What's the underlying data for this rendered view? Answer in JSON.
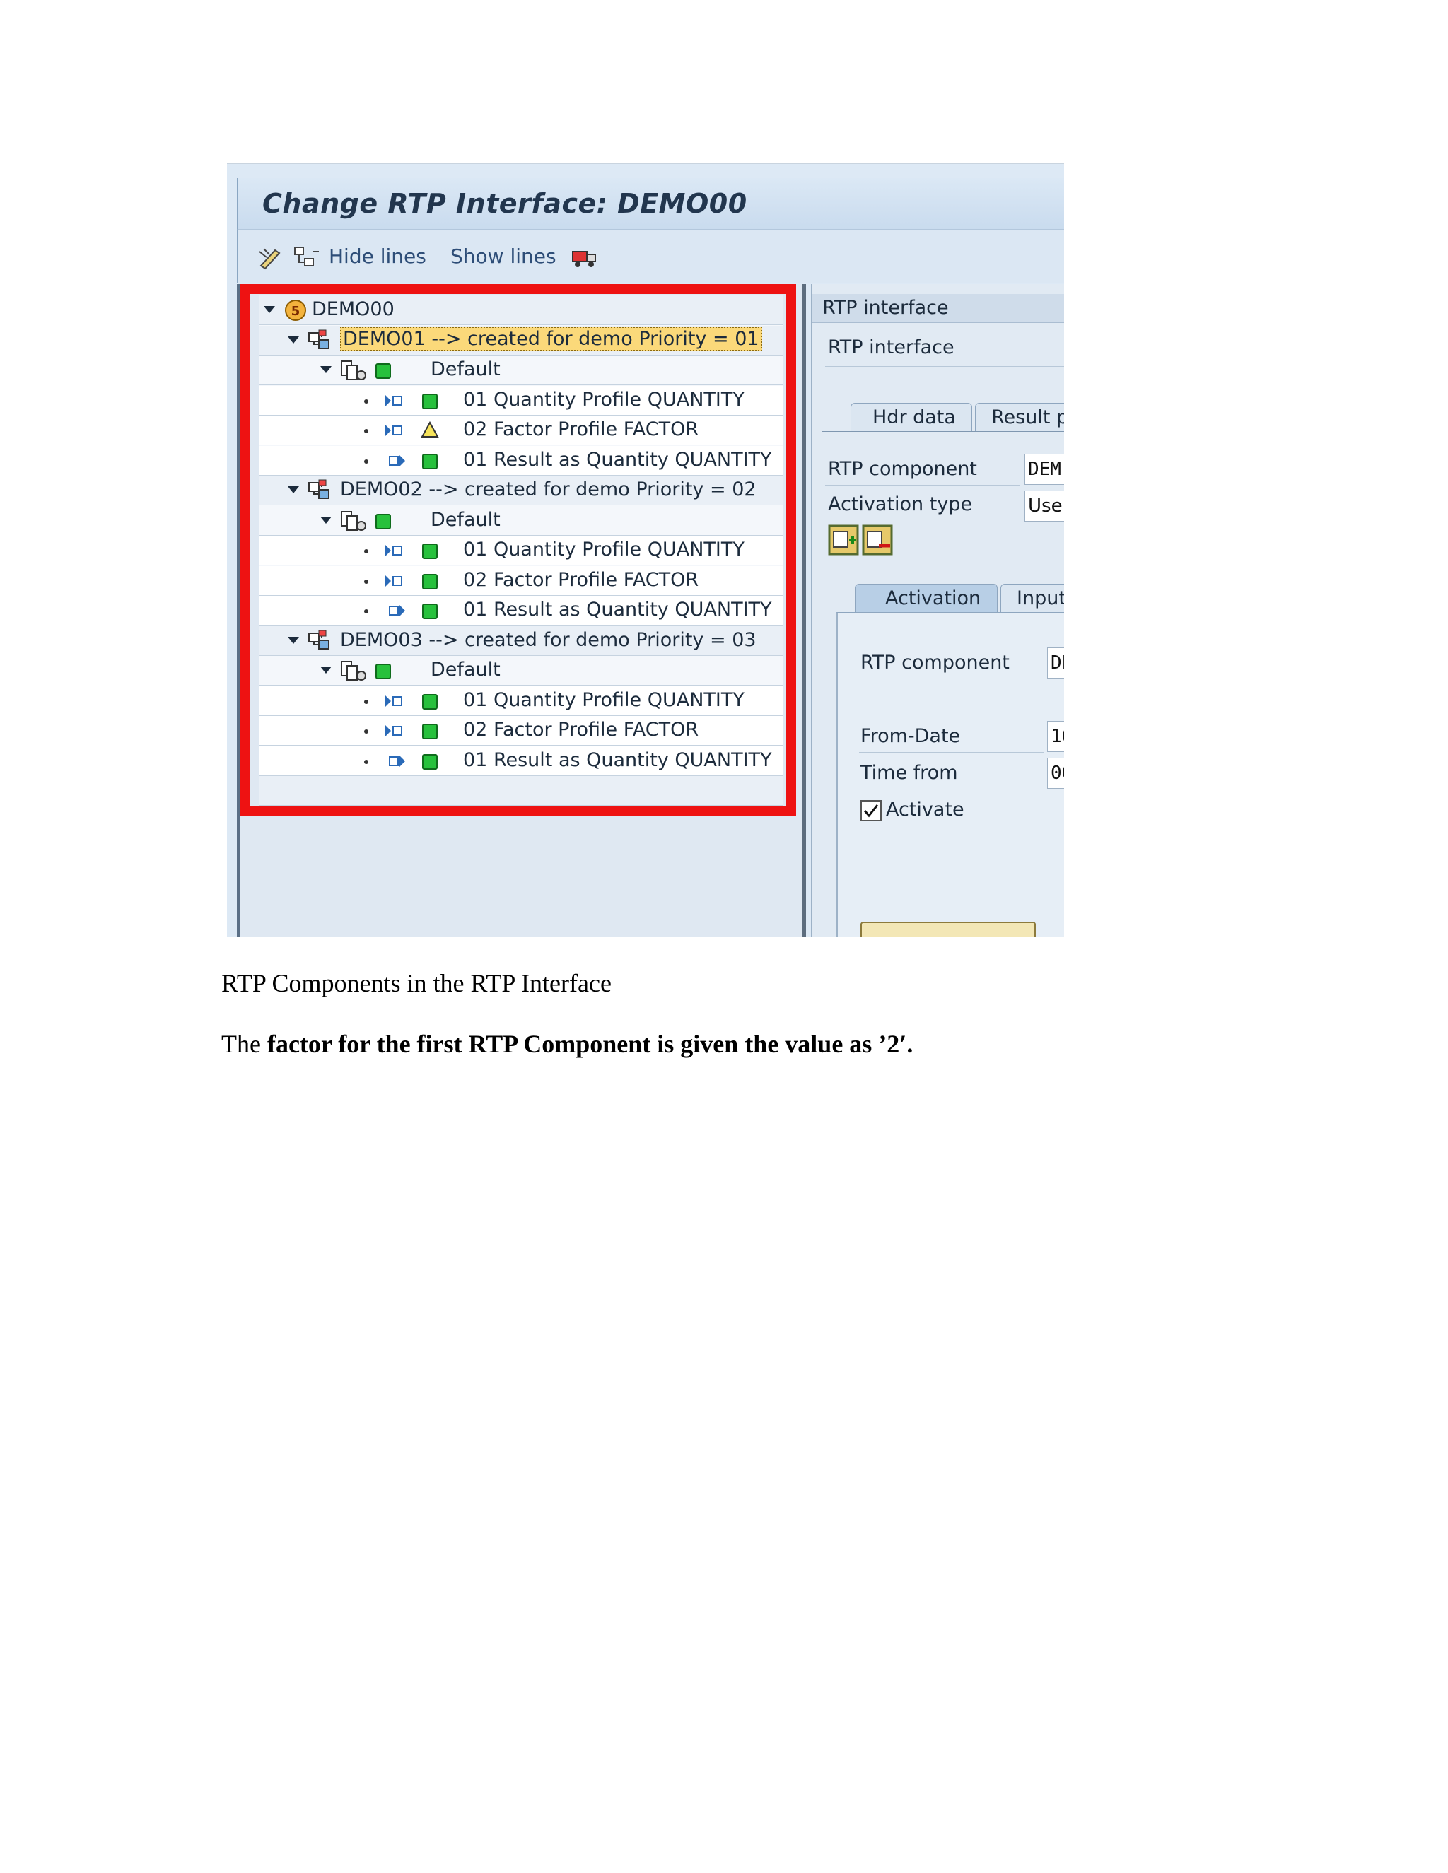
{
  "window": {
    "title": "Change RTP Interface: DEMO00",
    "toolbar": {
      "hide_lines": "Hide lines",
      "show_lines": "Show lines"
    }
  },
  "tree": {
    "root": {
      "label": "DEMO00",
      "icon": "root-badge-icon"
    },
    "components": [
      {
        "label": "DEMO01 --> created for demo Priority = 01",
        "selected": true,
        "group": "Default",
        "items": [
          {
            "label": "01 Quantity Profile QUANTITY",
            "status": "green",
            "kind": "input"
          },
          {
            "label": "02 Factor Profile FACTOR",
            "status": "warning",
            "kind": "input"
          },
          {
            "label": "01 Result as Quantity QUANTITY",
            "status": "green",
            "kind": "output"
          }
        ]
      },
      {
        "label": "DEMO02 --> created for demo Priority = 02",
        "selected": false,
        "group": "Default",
        "items": [
          {
            "label": "01 Quantity Profile QUANTITY",
            "status": "green",
            "kind": "input"
          },
          {
            "label": "02 Factor Profile FACTOR",
            "status": "green",
            "kind": "input"
          },
          {
            "label": "01 Result as Quantity QUANTITY",
            "status": "green",
            "kind": "output"
          }
        ]
      },
      {
        "label": "DEMO03 --> created for demo Priority = 03",
        "selected": false,
        "group": "Default",
        "items": [
          {
            "label": "01 Quantity Profile QUANTITY",
            "status": "green",
            "kind": "input"
          },
          {
            "label": "02 Factor Profile FACTOR",
            "status": "green",
            "kind": "input"
          },
          {
            "label": "01 Result as Quantity QUANTITY",
            "status": "green",
            "kind": "output"
          }
        ]
      }
    ]
  },
  "right": {
    "header": "RTP interface",
    "subheader": "RTP interface",
    "tabs": [
      "Hdr data",
      "Result p"
    ],
    "rtp_component_label": "RTP component",
    "rtp_component_value": "DEM(",
    "activation_type_label": "Activation type",
    "activation_type_value": "Use",
    "subtabs": [
      "Activation",
      "Input"
    ],
    "sub_rtp_component_label": "RTP component",
    "sub_rtp_component_value": "DE",
    "from_date_label": "From-Date",
    "from_date_value": "16",
    "time_from_label": "Time from",
    "time_from_value": "00",
    "activate_label": "Activate",
    "activate_checked": true
  },
  "caption": "RTP Components in the RTP Interface",
  "paragraph": {
    "prefix": "The ",
    "bold": "factor for the first RTP Component is given the value as ’2′."
  },
  "colors": {
    "highlight_frame": "#ee1212",
    "status_green": "#27c13c",
    "selection": "#fbd97a"
  }
}
